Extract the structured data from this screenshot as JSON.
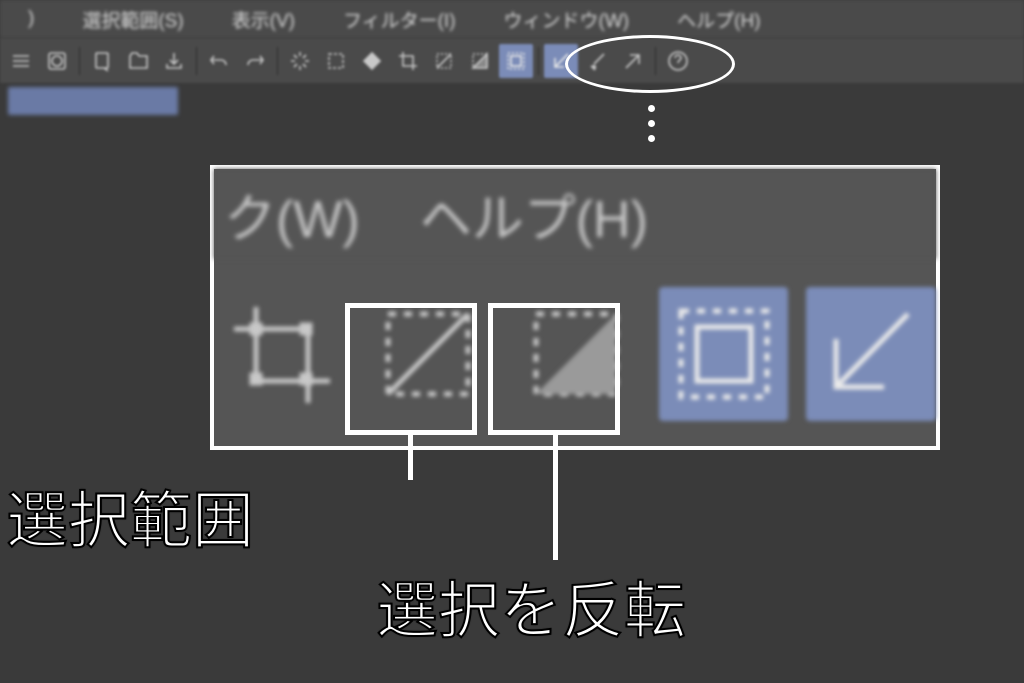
{
  "menubar": {
    "items": [
      {
        "label": ")"
      },
      {
        "label": "選択範囲(S)"
      },
      {
        "label": "表示(V)"
      },
      {
        "label": "フィルター(I)"
      },
      {
        "label": "ウィンドウ(W)"
      },
      {
        "label": "ヘルプ(H)"
      }
    ]
  },
  "zoom_menu": {
    "left": "ク(W)",
    "right": "ヘルプ(H)"
  },
  "annotations": {
    "label1": "選択範囲",
    "label2": "選択を反転"
  }
}
